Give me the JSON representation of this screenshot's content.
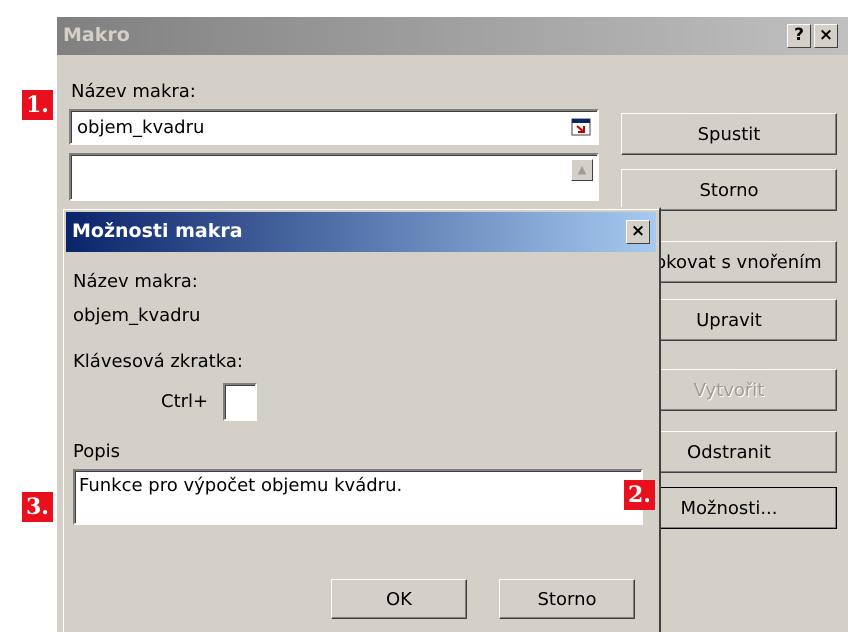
{
  "macro_dialog": {
    "title": "Makro",
    "help_button": "?",
    "close_button": "×",
    "name_label": "Název makra:",
    "name_value": "objem_kvadru",
    "buttons": {
      "run": "Spustit",
      "cancel": "Storno",
      "step_into": "Krokovat s vnořením",
      "edit": "Upravit",
      "create": "Vytvořit",
      "delete": "Odstranit",
      "options": "Možnosti..."
    }
  },
  "options_dialog": {
    "title": "Možnosti makra",
    "close_button": "×",
    "name_label": "Název makra:",
    "name_value": "objem_kvadru",
    "shortcut_label": "Klávesová zkratka:",
    "ctrl_prefix": "Ctrl+",
    "shortcut_value": "",
    "description_label": "Popis",
    "description_value": "Funkce pro výpočet objemu kvádru.",
    "ok_button": "OK",
    "cancel_button": "Storno"
  },
  "annotations": {
    "step1": "1.",
    "step2": "2.",
    "step3": "3."
  },
  "colors": {
    "dialog_face": "#d4d0c8",
    "active_title_start": "#0a246a",
    "active_title_end": "#a6caf0",
    "inactive_title_start": "#808080",
    "inactive_title_end": "#c0c0c0",
    "badge": "#e8101c"
  },
  "icons": {
    "name_field_button": "select-range-icon",
    "list_scroll": "scroll-up-arrow-icon"
  }
}
